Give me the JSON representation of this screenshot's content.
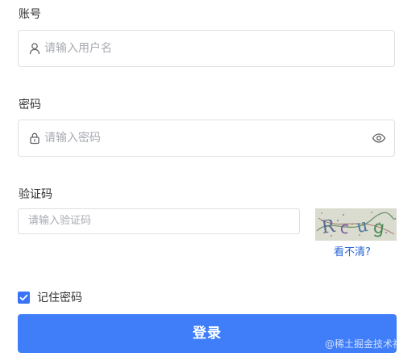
{
  "account": {
    "label": "账号",
    "placeholder": "请输入用户名",
    "icon": "user-icon"
  },
  "password": {
    "label": "密码",
    "placeholder": "请输入密码",
    "icon": "lock-icon",
    "toggle_icon": "eye-icon"
  },
  "captcha": {
    "label": "验证码",
    "placeholder": "请输入验证码",
    "image_text": "Rcug",
    "refresh_label": "看不清?"
  },
  "remember": {
    "label": "记住密码",
    "checked": true
  },
  "submit": {
    "label": "登录"
  },
  "watermark": "@稀土掘金技术社区",
  "colors": {
    "primary": "#3f7ef8",
    "link": "#2a64d8",
    "border": "#dcdfe6",
    "placeholder": "#a8abb2"
  }
}
